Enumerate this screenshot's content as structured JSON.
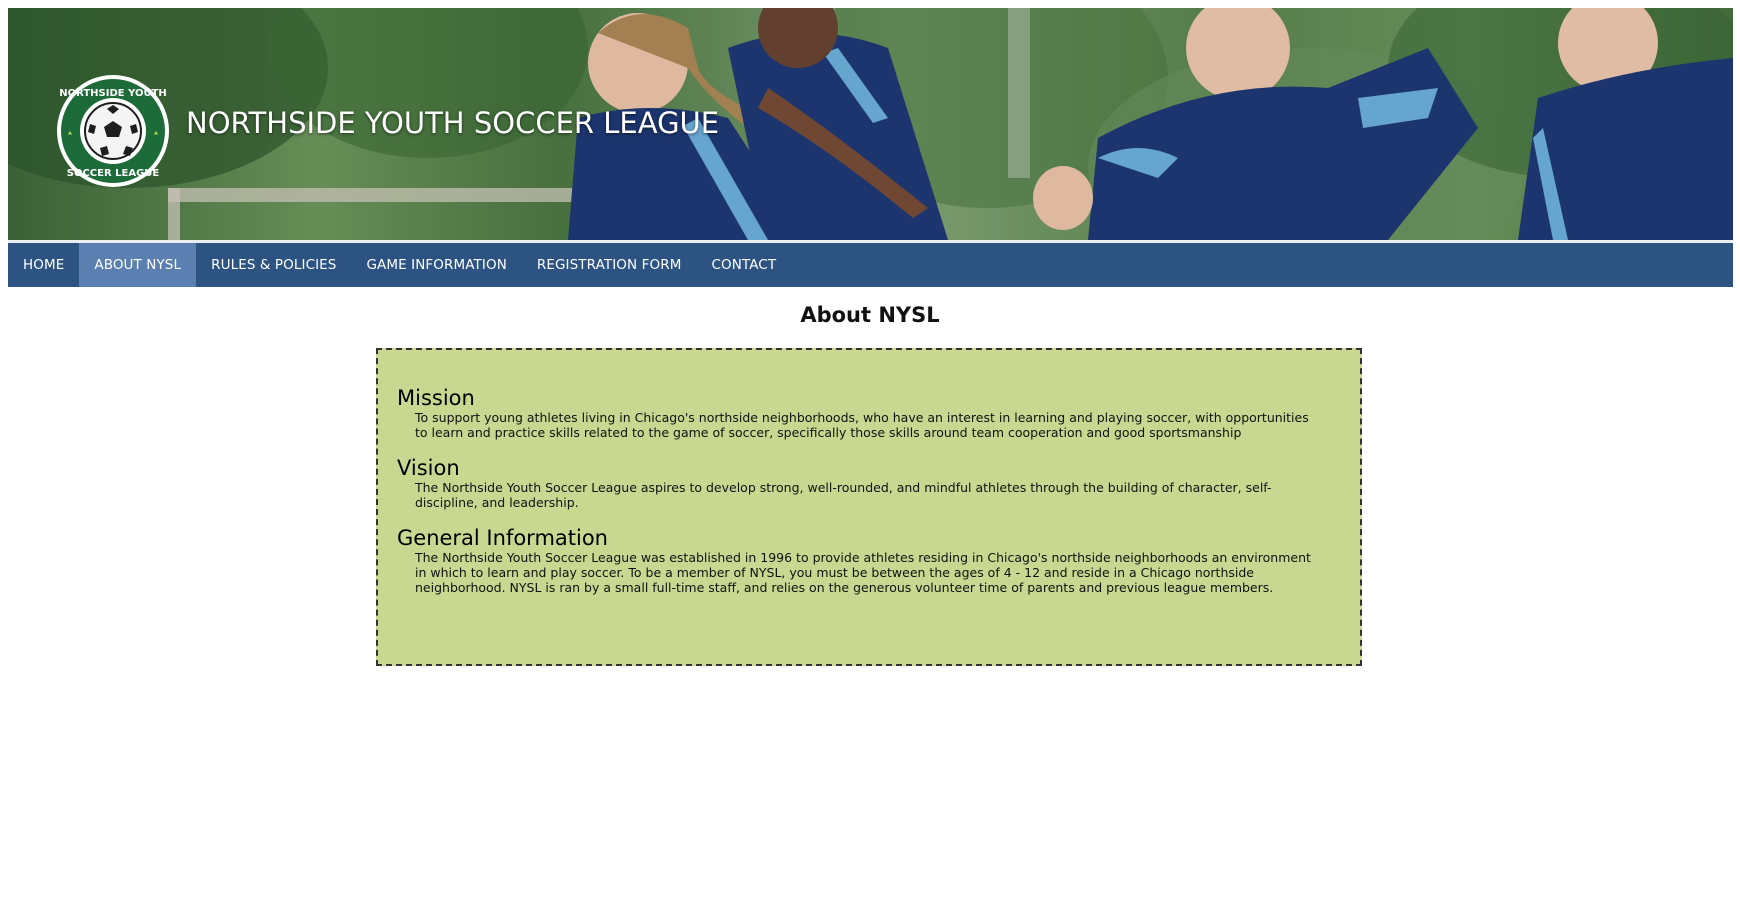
{
  "header": {
    "site_title": "NORTHSIDE YOUTH SOCCER LEAGUE",
    "logo_text_top": "NORTHSIDE YOUTH",
    "logo_text_bottom": "SOCCER LEAGUE",
    "logo_icon": "soccer-ball-icon"
  },
  "nav": {
    "items": [
      {
        "label": "HOME",
        "active": false
      },
      {
        "label": "ABOUT NYSL",
        "active": true
      },
      {
        "label": "RULES & POLICIES",
        "active": false
      },
      {
        "label": "GAME INFORMATION",
        "active": false
      },
      {
        "label": "REGISTRATION FORM",
        "active": false
      },
      {
        "label": "CONTACT",
        "active": false
      }
    ]
  },
  "main": {
    "title": "About NYSL",
    "sections": [
      {
        "heading": "Mission",
        "text": "To support young athletes living in Chicago's northside neighborhoods, who have an interest in learning and playing soccer, with opportunities to learn and practice skills related to the game of soccer, specifically those skills around team cooperation and good sportsmanship"
      },
      {
        "heading": "Vision",
        "text": "The Northside Youth Soccer League aspires to develop strong, well-rounded, and mindful athletes through the building of character, self-discipline, and leadership."
      },
      {
        "heading": "General Information",
        "text": "The Northside Youth Soccer League was established in 1996 to provide athletes residing in Chicago's northside neighborhoods an environment in which to learn and play soccer. To be a member of NYSL, you must be between the ages of 4 - 12 and reside in a Chicago northside neighborhood. NYSL is ran by a small full-time staff, and relies on the generous volunteer time of parents and previous league members."
      }
    ]
  },
  "colors": {
    "nav_bg": "#2c5382",
    "nav_active": "#5b7fb0",
    "box_bg": "#c8d890",
    "jersey_navy": "#1f3a78",
    "jersey_accent": "#6fb3e0",
    "logo_green": "#1e6b3a"
  }
}
